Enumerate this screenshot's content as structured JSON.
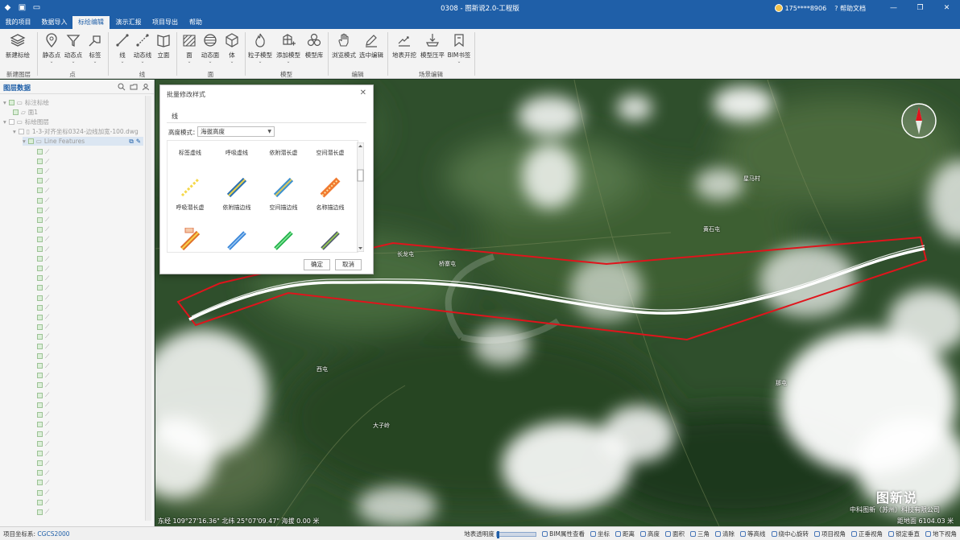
{
  "window": {
    "title": "0308 - 图新说2.0-工程版",
    "user": "175****8906",
    "help": "帮助文档"
  },
  "menu": {
    "tabs": [
      {
        "label": "我的项目"
      },
      {
        "label": "数据导入"
      },
      {
        "label": "标绘编辑"
      },
      {
        "label": "演示汇报"
      },
      {
        "label": "项目导出"
      },
      {
        "label": "帮助"
      }
    ],
    "active": "标绘编辑"
  },
  "ribbon": {
    "tools": [
      {
        "label": "新建标绘",
        "icon": "layers-icon"
      },
      {
        "label": "静态点",
        "icon": "map-pin-icon"
      },
      {
        "label": "动态点",
        "icon": "funnel-pin-icon"
      },
      {
        "label": "标签",
        "icon": "tag-icon"
      },
      {
        "label": "线",
        "icon": "line-icon"
      },
      {
        "label": "动态线",
        "icon": "dynamic-line-icon"
      },
      {
        "label": "立面",
        "icon": "book-icon"
      },
      {
        "label": "面",
        "icon": "hatch-polygon-icon"
      },
      {
        "label": "动态面",
        "icon": "sphere-icon"
      },
      {
        "label": "体",
        "icon": "cube-icon"
      },
      {
        "label": "粒子模型",
        "icon": "fire-icon"
      },
      {
        "label": "添加模型",
        "icon": "model-add-icon"
      },
      {
        "label": "模型库",
        "icon": "model-library-icon"
      },
      {
        "label": "浏览模式",
        "icon": "hand-icon"
      },
      {
        "label": "选中编辑",
        "icon": "pen-icon"
      },
      {
        "label": "地表开挖",
        "icon": "excavate-icon"
      },
      {
        "label": "模型压平",
        "icon": "flatten-icon"
      },
      {
        "label": "BIM书签",
        "icon": "bookmark-icon"
      }
    ],
    "groups": [
      "新建图层",
      "点",
      "线",
      "面",
      "模型",
      "编辑",
      "场景编辑"
    ]
  },
  "layers": {
    "title": "图层数据",
    "items": [
      {
        "label": "标注标绘"
      },
      {
        "label": "面1"
      },
      {
        "label": "标绘图层"
      },
      {
        "label": "1-3-对齐坐标0324-边线加宽-100.dwg"
      },
      {
        "label": "Line Features"
      }
    ]
  },
  "dialog": {
    "title": "批量修改样式",
    "section": "线",
    "height_mode_label": "高度模式：",
    "height_mode_value": "海拔高度",
    "styles": [
      {
        "label": "标签虚线"
      },
      {
        "label": "呼吸虚线"
      },
      {
        "label": "依附潜长虚"
      },
      {
        "label": "空间潜长虚"
      },
      {
        "label": "呼吸潜长虚"
      },
      {
        "label": "依附描边线"
      },
      {
        "label": "空间描边线"
      },
      {
        "label": "名称描边线"
      }
    ],
    "ok": "确定",
    "cancel": "取消"
  },
  "map": {
    "places": [
      {
        "label": "长龙屯"
      },
      {
        "label": "桥寨屯"
      },
      {
        "label": "星马村"
      },
      {
        "label": "黄石屯"
      },
      {
        "label": "西屯"
      },
      {
        "label": "大子岭"
      },
      {
        "label": "那屯"
      }
    ],
    "coords": "东经 109°27'16.36\"  北纬 25°07'09.47\"  海拔 0.00 米",
    "distance": "距地面 6104.03 米",
    "brand": "图新说",
    "brand_sub": "中科图新（苏州）科技有限公司"
  },
  "status": {
    "crs_label": "项目坐标系:",
    "crs_value": "CGCS2000",
    "items": [
      {
        "label": "地表透明度"
      },
      {
        "label": "BIM属性查看"
      },
      {
        "label": "坐标"
      },
      {
        "label": "距离"
      },
      {
        "label": "高度"
      },
      {
        "label": "面积"
      },
      {
        "label": "三角"
      },
      {
        "label": "清除"
      },
      {
        "label": "等高线"
      },
      {
        "label": "绕中心旋转"
      },
      {
        "label": "项目视角"
      },
      {
        "label": "正垂视角"
      },
      {
        "label": "锁定垂直"
      },
      {
        "label": "地下视角"
      }
    ]
  },
  "colors": {
    "accent": "#1f5fa8",
    "route_outline": "#e0141c",
    "route_line": "#ffffff"
  }
}
